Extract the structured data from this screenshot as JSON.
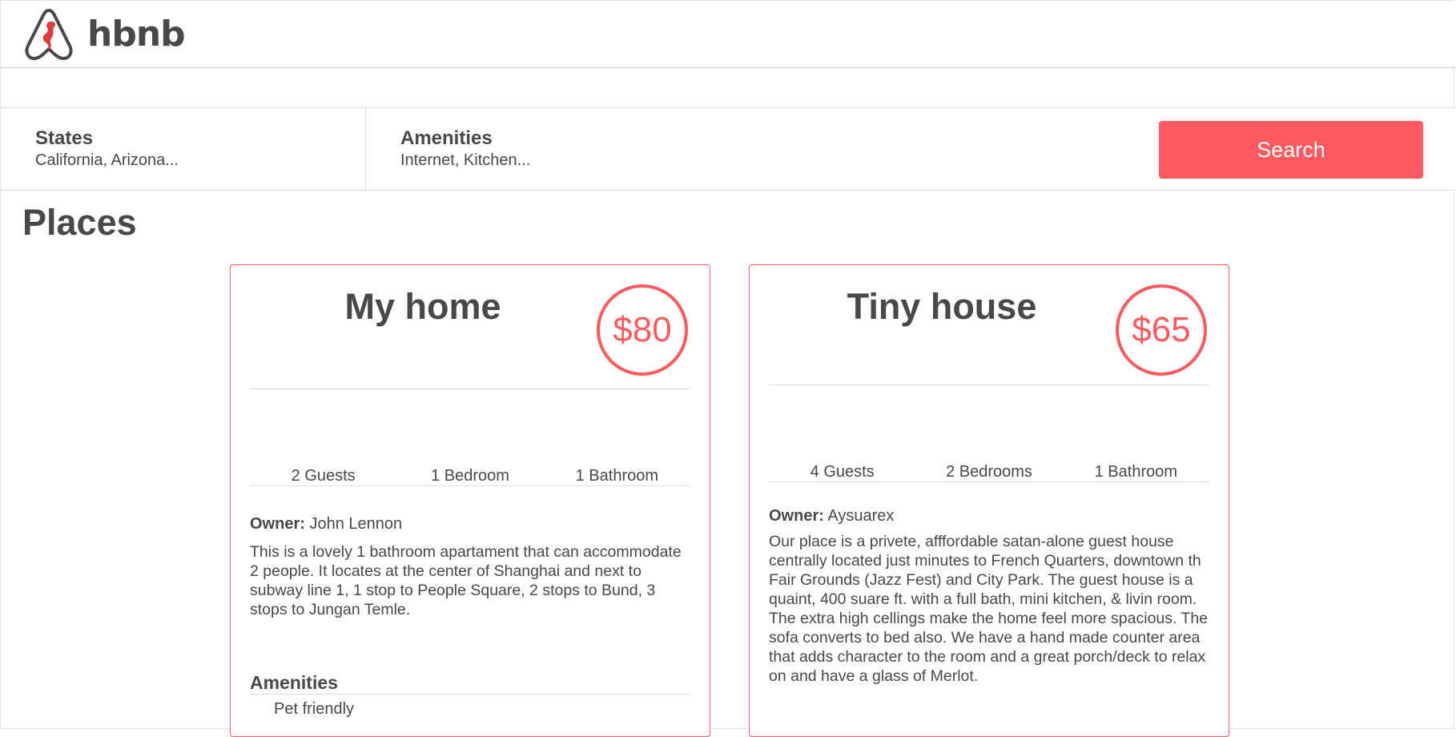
{
  "header": {
    "logo_text": "hbnb"
  },
  "filters": {
    "states": {
      "title": "States",
      "value": "California, Arizona..."
    },
    "amenities": {
      "title": "Amenities",
      "value": "Internet, Kitchen..."
    },
    "search_label": "Search"
  },
  "places_title": "Places",
  "places": [
    {
      "name": "My home",
      "price": "$80",
      "guests": "2 Guests",
      "rooms": "1 Bedroom",
      "bathrooms": "1 Bathroom",
      "owner_label": "Owner:",
      "owner": "John Lennon",
      "description": "This is a lovely 1 bathroom apartament that can accommodate 2 people. It locates at the center of Shanghai and next to subway line 1, 1 stop to People Square, 2 stops to Bund, 3 stops to Jungan Temle.",
      "amenities_title": "Amenities",
      "amenities": [
        "Pet friendly"
      ]
    },
    {
      "name": "Tiny house",
      "price": "$65",
      "guests": "4 Guests",
      "rooms": "2 Bedrooms",
      "bathrooms": "1 Bathroom",
      "owner_label": "Owner:",
      "owner": "Aysuarex",
      "description": "Our place is a privete, afffordable satan-alone guest house centrally located just minutes to French Quarters, downtown th Fair Grounds (Jazz Fest) and City Park. The guest house is a quaint, 400 suare ft. with a full bath, mini kitchen, & livin room. The extra high cellings make the home feel more spacious. The sofa converts to bed also. We have a hand made counter area that adds character to the room and a great porch/deck to relax on and have a glass of Merlot."
    }
  ],
  "colors": {
    "accent": "#ff5a5f",
    "text": "#484848",
    "divider": "#dcdcdc"
  }
}
